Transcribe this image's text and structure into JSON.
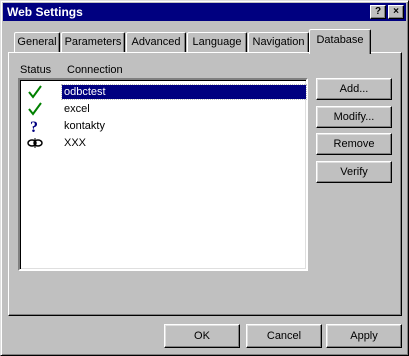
{
  "window": {
    "title": "Web Settings",
    "help_label": "?",
    "close_label": "×"
  },
  "tabs": [
    {
      "label": "General"
    },
    {
      "label": "Parameters"
    },
    {
      "label": "Advanced"
    },
    {
      "label": "Language"
    },
    {
      "label": "Navigation"
    },
    {
      "label": "Database",
      "active": true
    }
  ],
  "list": {
    "headers": {
      "status": "Status",
      "connection": "Connection"
    },
    "rows": [
      {
        "status_icon": "checkmark-icon",
        "name": "odbctest",
        "selected": true
      },
      {
        "status_icon": "checkmark-icon",
        "name": "excel"
      },
      {
        "status_icon": "question-mark-icon",
        "name": "kontakty"
      },
      {
        "status_icon": "broken-link-icon",
        "name": "XXX"
      }
    ]
  },
  "side_buttons": {
    "add": "Add...",
    "modify": "Modify...",
    "remove": "Remove",
    "verify": "Verify"
  },
  "footer_buttons": {
    "ok": "OK",
    "cancel": "Cancel",
    "apply": "Apply"
  },
  "colors": {
    "titlebar": "#000080",
    "selection": "#000080",
    "check": "#008000",
    "question": "#000080"
  }
}
